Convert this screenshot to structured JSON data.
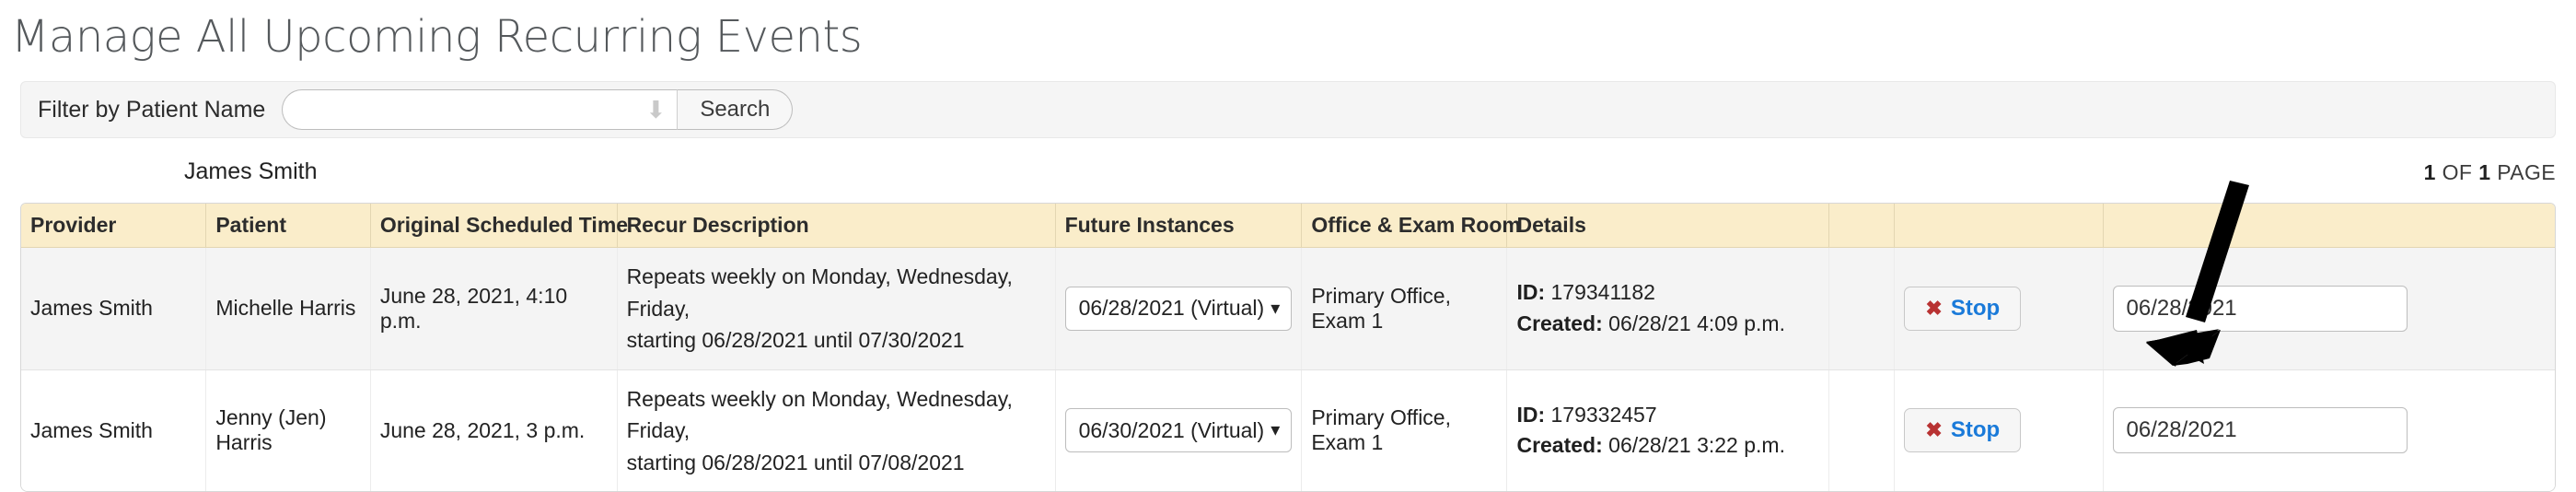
{
  "page": {
    "title": "Manage All Upcoming Recurring Events"
  },
  "filter": {
    "label": "Filter by Patient Name",
    "input_value": "",
    "input_placeholder": "",
    "dropdown_arrow_icon": "arrow-down-icon",
    "search_label": "Search"
  },
  "strip": {
    "provider_name": "James Smith",
    "pager_current": "1",
    "pager_of": "OF",
    "pager_total": "1",
    "pager_suffix": "PAGE"
  },
  "table": {
    "headers": [
      "Provider",
      "Patient",
      "Original Scheduled Time",
      "Recur Description",
      "Future Instances",
      "Office & Exam Room",
      "Details",
      "",
      "",
      ""
    ],
    "rows": [
      {
        "provider": "James Smith",
        "patient": "Michelle Harris",
        "original_time": "June 28, 2021, 4:10 p.m.",
        "recur_line1": "Repeats weekly on Monday, Wednesday, Friday,",
        "recur_line2": "starting 06/28/2021 until 07/30/2021",
        "future_instance": "06/28/2021 (Virtual)",
        "office": "Primary Office, Exam 1",
        "id_label": "ID:",
        "id_value": "179341182",
        "created_label": "Created:",
        "created_value": "06/28/21 4:09 p.m.",
        "stop_label": "Stop",
        "stop_icon": "x-mark-icon",
        "stop_date": "06/28/2021"
      },
      {
        "provider": "James Smith",
        "patient": "Jenny (Jen) Harris",
        "original_time": "June 28, 2021, 3 p.m.",
        "recur_line1": "Repeats weekly on Monday, Wednesday, Friday,",
        "recur_line2": "starting 06/28/2021 until 07/08/2021",
        "future_instance": "06/30/2021 (Virtual)",
        "office": "Primary Office, Exam 1",
        "id_label": "ID:",
        "id_value": "179332457",
        "created_label": "Created:",
        "created_value": "06/28/21 3:22 p.m.",
        "stop_label": "Stop",
        "stop_icon": "x-mark-icon",
        "stop_date": "06/28/2021"
      }
    ]
  },
  "annotation": {
    "arrow_icon": "pointer-arrow-icon",
    "arrow_color": "#000000"
  },
  "colors": {
    "header_background": "#faedca",
    "row_alt_background": "#f4f4f4",
    "filter_panel_background": "#f5f5f5",
    "stop_text": "#1a7ad9",
    "stop_mark": "#b83232",
    "title_text": "#55595c"
  }
}
